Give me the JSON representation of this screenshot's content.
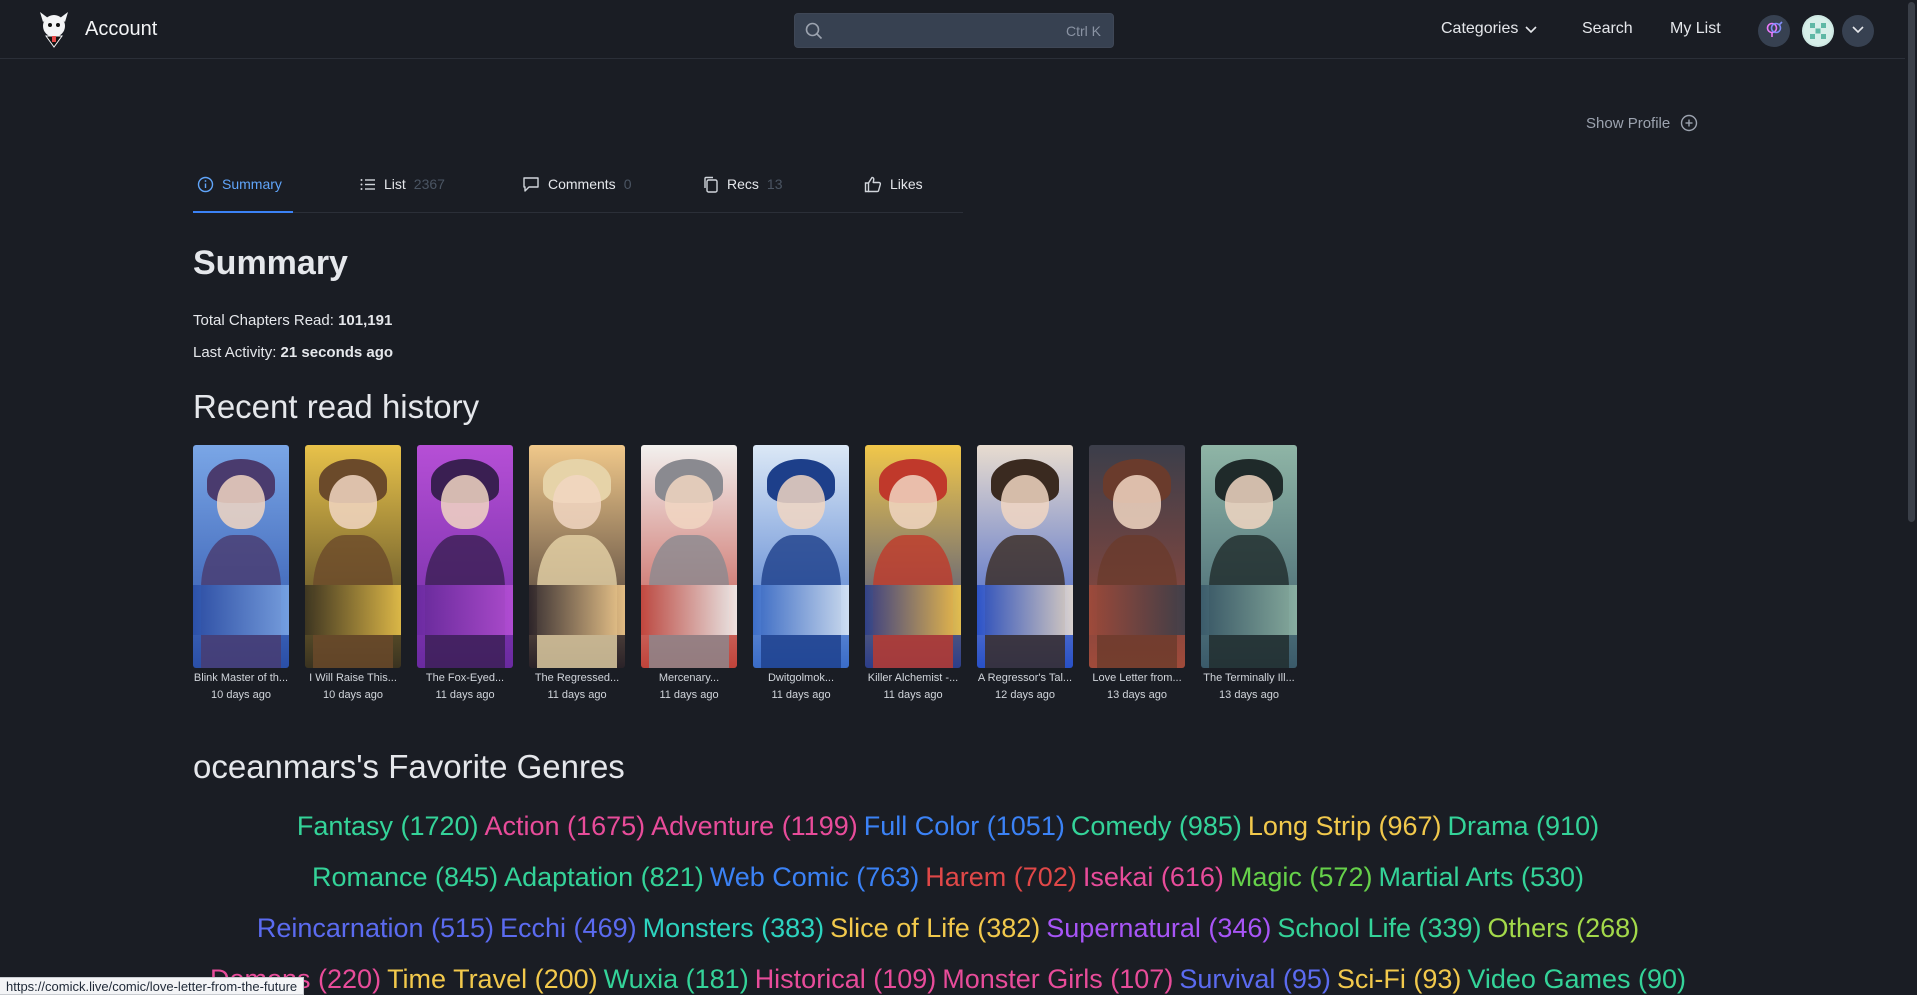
{
  "header": {
    "brand": "Account",
    "search_shortcut": "Ctrl K",
    "nav": {
      "categories": "Categories",
      "search": "Search",
      "my_list": "My List"
    }
  },
  "profile": {
    "show_profile": "Show Profile"
  },
  "tabs": [
    {
      "label": "Summary",
      "count": ""
    },
    {
      "label": "List",
      "count": "2367"
    },
    {
      "label": "Comments",
      "count": "0"
    },
    {
      "label": "Recs",
      "count": "13"
    },
    {
      "label": "Likes",
      "count": ""
    }
  ],
  "summary": {
    "heading": "Summary",
    "chapters_label": "Total Chapters Read: ",
    "chapters_value": "101,191",
    "activity_label": "Last Activity: ",
    "activity_value": "21 seconds ago"
  },
  "history": {
    "heading": "Recent read history",
    "items": [
      {
        "title": "Blink Master of th...",
        "ago": "10 days ago",
        "colors": [
          "#7aa6e6",
          "#4a3b6e",
          "#2a4fa8"
        ]
      },
      {
        "title": "I Will Raise This...",
        "ago": "10 days ago",
        "colors": [
          "#e8c24a",
          "#6b4a2a",
          "#3a3320"
        ]
      },
      {
        "title": "The Fox-Eyed...",
        "ago": "11 days ago",
        "colors": [
          "#b64fd6",
          "#3a1f52",
          "#6a2aa0"
        ]
      },
      {
        "title": "The Regressed...",
        "ago": "11 days ago",
        "colors": [
          "#f0c88a",
          "#e6d3a8",
          "#2a2228"
        ]
      },
      {
        "title": "Mercenary...",
        "ago": "11 days ago",
        "colors": [
          "#f2f0ee",
          "#8a8a90",
          "#c0433a"
        ]
      },
      {
        "title": "Dwitgolmok...",
        "ago": "11 days ago",
        "colors": [
          "#dbe8f6",
          "#1d3f8a",
          "#3a6cc8"
        ]
      },
      {
        "title": "Killer Alchemist -...",
        "ago": "11 days ago",
        "colors": [
          "#f1c74a",
          "#c0392b",
          "#2c3e8a"
        ]
      },
      {
        "title": "A Regressor's Tal...",
        "ago": "12 days ago",
        "colors": [
          "#e8dccf",
          "#3a2a20",
          "#2850c8"
        ]
      },
      {
        "title": "Love Letter from...",
        "ago": "13 days ago",
        "colors": [
          "#3b3e4a",
          "#6a3b2c",
          "#a04a3a"
        ]
      },
      {
        "title": "The Terminally Ill...",
        "ago": "13 days ago",
        "colors": [
          "#8fb5a6",
          "#1f2a2a",
          "#3a5a6a"
        ]
      }
    ]
  },
  "genres": {
    "heading": "oceanmars's Favorite Genres",
    "lines": [
      [
        {
          "label": "Fantasy (1720)",
          "color": "#34d399"
        },
        {
          "label": "Action (1675)",
          "color": "#e84c9a"
        },
        {
          "label": "Adventure (1199)",
          "color": "#e84c9a"
        },
        {
          "label": "Full Color (1051)",
          "color": "#3b82f6"
        },
        {
          "label": "Comedy (985)",
          "color": "#34d399"
        },
        {
          "label": "Long Strip (967)",
          "color": "#f2c94c"
        },
        {
          "label": "Drama (910)",
          "color": "#34d399"
        }
      ],
      [
        {
          "label": "Romance (845)",
          "color": "#34d399"
        },
        {
          "label": "Adaptation (821)",
          "color": "#34d399"
        },
        {
          "label": "Web Comic (763)",
          "color": "#3b82f6"
        },
        {
          "label": "Harem (702)",
          "color": "#e04848"
        },
        {
          "label": "Isekai (616)",
          "color": "#e84c9a"
        },
        {
          "label": "Magic (572)",
          "color": "#66d14a"
        },
        {
          "label": "Martial Arts (530)",
          "color": "#34d399"
        }
      ],
      [
        {
          "label": "Reincarnation (515)",
          "color": "#5b6bf0"
        },
        {
          "label": "Ecchi (469)",
          "color": "#5b6bf0"
        },
        {
          "label": "Monsters (383)",
          "color": "#2dd4bf"
        },
        {
          "label": "Slice of Life (382)",
          "color": "#f2c94c"
        },
        {
          "label": "Supernatural (346)",
          "color": "#a855f7"
        },
        {
          "label": "School Life (339)",
          "color": "#34d399"
        },
        {
          "label": "Others (268)",
          "color": "#a3d94a"
        }
      ],
      [
        {
          "label": "Demons (220)",
          "color": "#e84c9a"
        },
        {
          "label": "Time Travel (200)",
          "color": "#f2c94c"
        },
        {
          "label": "Wuxia (181)",
          "color": "#34d399"
        },
        {
          "label": "Historical (109)",
          "color": "#e84c9a"
        },
        {
          "label": "Monster Girls (107)",
          "color": "#e84c9a"
        },
        {
          "label": "Survival (95)",
          "color": "#5b6bf0"
        },
        {
          "label": "Sci-Fi (93)",
          "color": "#f2c94c"
        },
        {
          "label": "Video Games (90)",
          "color": "#34d399"
        }
      ]
    ]
  },
  "status_url": "https://comick.live/comic/love-letter-from-the-future"
}
